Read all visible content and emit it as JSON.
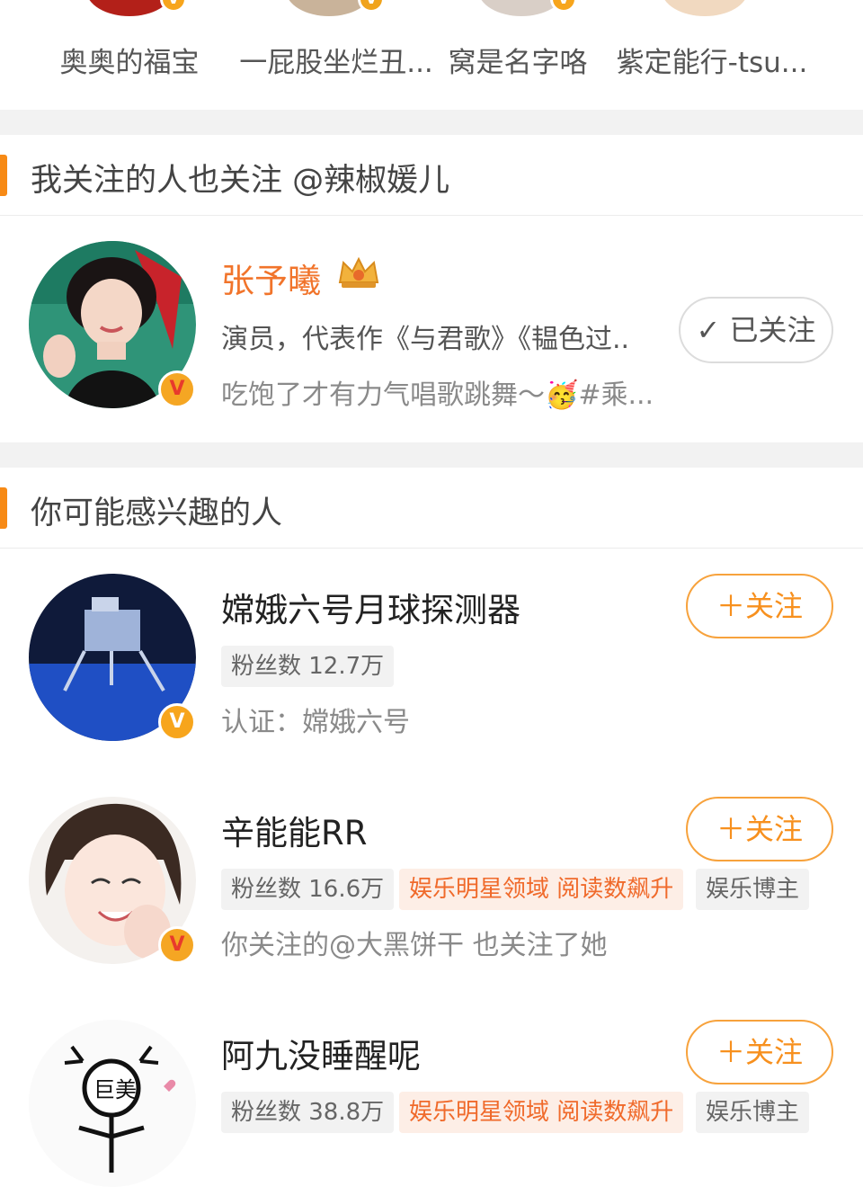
{
  "top_users": [
    {
      "name": "奥奥的福宝"
    },
    {
      "name": "一屁股坐烂丑..."
    },
    {
      "name": "窝是名字咯"
    },
    {
      "name": "紫定能行-tsu..."
    }
  ],
  "section_mutual": {
    "title": "我关注的人也关注 @辣椒媛儿"
  },
  "mutual_user": {
    "name": "张予曦",
    "description": "演员，代表作《与君歌》《韫色过..",
    "latest_post": "吃饱了才有力气唱歌跳舞～🥳#乘...",
    "follow_state": "已关注",
    "check_icon": "✓"
  },
  "section_suggest": {
    "title": "你可能感兴趣的人"
  },
  "suggested": [
    {
      "name": "嫦娥六号月球探测器",
      "fans": "粉丝数 12.7万",
      "verify": "认证：嫦娥六号",
      "follow": "＋关注"
    },
    {
      "name": "辛能能RR",
      "fans": "粉丝数 16.6万",
      "hot_tag": "娱乐明星领域 阅读数飙升",
      "role_tag": "娱乐博主",
      "reason": "你关注的@大黑饼干 也关注了她",
      "follow": "＋关注"
    },
    {
      "name": "阿九没睡醒呢",
      "fans": "粉丝数 38.8万",
      "hot_tag": "娱乐明星领域 阅读数飙升",
      "role_tag": "娱乐博主",
      "follow": "＋关注"
    }
  ],
  "badges": {
    "verified": "V"
  },
  "colors": {
    "accent": "#f78a16",
    "follow": "#f7901e",
    "vip_name": "#f1742b",
    "badge": "#f7a51c"
  }
}
